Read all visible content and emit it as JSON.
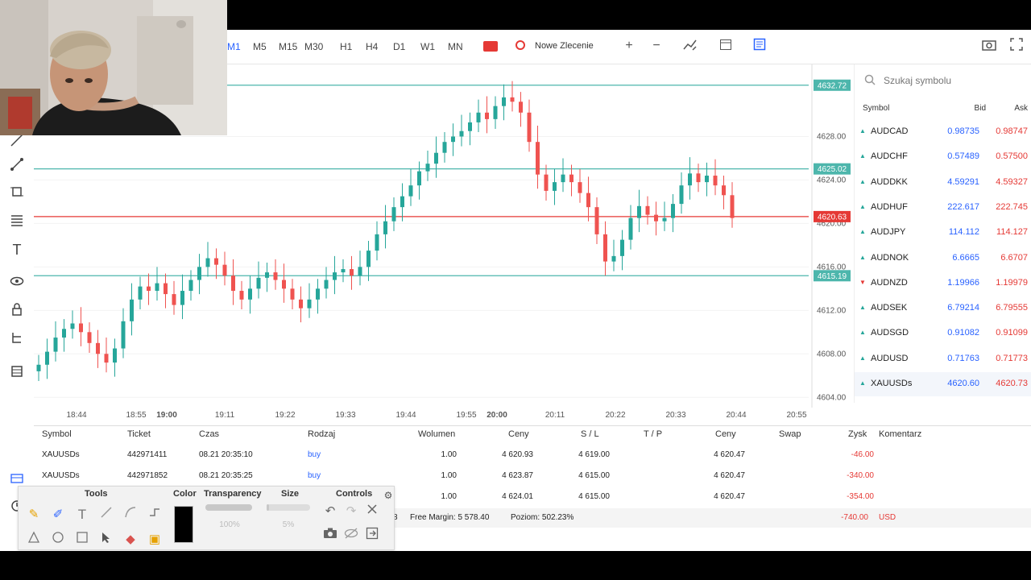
{
  "toolbar": {
    "timeframes": [
      "M1",
      "M5",
      "M15",
      "M30",
      "H1",
      "H4",
      "D1",
      "W1",
      "MN"
    ],
    "new_order_label": "Nowe Zlecenie",
    "icons": [
      "plus-icon",
      "minus-icon",
      "indicators-icon",
      "calendar-icon",
      "template-icon",
      "screenshot-icon",
      "fullscreen-icon"
    ]
  },
  "chart_data": {
    "type": "candlestick",
    "symbol": "XAUUSDs",
    "x_ticks": [
      "18:44",
      "18:55",
      "19:00",
      "19:11",
      "19:22",
      "19:33",
      "19:44",
      "19:55",
      "20:00",
      "20:11",
      "20:22",
      "20:33",
      "20:44",
      "20:55"
    ],
    "y_ticks": [
      "4628.00",
      "4624.00",
      "4620.00",
      "4616.00",
      "4612.00",
      "4608.00",
      "4604.00"
    ],
    "ylim": [
      4603.5,
      4633.0
    ],
    "horizontal_lines": [
      {
        "price": 4632.72,
        "label": "4632.72",
        "color": "#4db6ac"
      },
      {
        "price": 4625.02,
        "label": "4625.02",
        "color": "#4db6ac"
      },
      {
        "price": 4620.63,
        "label": "4620.63",
        "color": "#e53935"
      },
      {
        "price": 4615.19,
        "label": "4615.19",
        "color": "#4db6ac"
      }
    ],
    "up_color": "#26a69a",
    "down_color": "#ef5350",
    "closes": [
      4607.0,
      4608.2,
      4609.5,
      4610.3,
      4610.8,
      4610.0,
      4609.0,
      4608.0,
      4607.2,
      4608.5,
      4611.0,
      4613.0,
      4614.2,
      4613.8,
      4614.5,
      4613.5,
      4612.5,
      4613.8,
      4614.8,
      4616.0,
      4616.8,
      4616.2,
      4615.2,
      4613.8,
      4613.0,
      4614.0,
      4615.0,
      4615.5,
      4614.8,
      4614.0,
      4613.0,
      4612.2,
      4613.0,
      4614.0,
      4614.8,
      4615.5,
      4615.8,
      4615.2,
      4616.0,
      4617.5,
      4619.0,
      4620.2,
      4621.5,
      4622.5,
      4623.5,
      4624.8,
      4625.5,
      4626.5,
      4627.5,
      4628.0,
      4628.5,
      4629.3,
      4630.2,
      4629.6,
      4630.8,
      4631.6,
      4631.2,
      4630.2,
      4627.5,
      4624.5,
      4623.0,
      4623.8,
      4624.5,
      4623.8,
      4622.8,
      4621.5,
      4619.0,
      4616.5,
      4617.0,
      4618.5,
      4620.5,
      4621.6,
      4620.8,
      4620.2,
      4620.5,
      4621.8,
      4623.5,
      4624.6,
      4623.8,
      4624.4,
      4623.5,
      4622.6,
      4620.5
    ]
  },
  "watchlist": {
    "search_placeholder": "Szukaj symbolu",
    "headers": {
      "symbol": "Symbol",
      "bid": "Bid",
      "ask": "Ask"
    },
    "rows": [
      {
        "symbol": "AUDCAD",
        "bid": "0.98735",
        "ask": "0.98747",
        "dir": "up"
      },
      {
        "symbol": "AUDCHF",
        "bid": "0.57489",
        "ask": "0.57500",
        "dir": "up"
      },
      {
        "symbol": "AUDDKK",
        "bid": "4.59291",
        "ask": "4.59327",
        "dir": "up"
      },
      {
        "symbol": "AUDHUF",
        "bid": "222.617",
        "ask": "222.745",
        "dir": "up"
      },
      {
        "symbol": "AUDJPY",
        "bid": "114.112",
        "ask": "114.127",
        "dir": "up"
      },
      {
        "symbol": "AUDNOK",
        "bid": "6.6665",
        "ask": "6.6707",
        "dir": "up"
      },
      {
        "symbol": "AUDNZD",
        "bid": "1.19966",
        "ask": "1.19979",
        "dir": "down"
      },
      {
        "symbol": "AUDSEK",
        "bid": "6.79214",
        "ask": "6.79555",
        "dir": "up"
      },
      {
        "symbol": "AUDSGD",
        "bid": "0.91082",
        "ask": "0.91099",
        "dir": "up"
      },
      {
        "symbol": "AUDUSD",
        "bid": "0.71763",
        "ask": "0.71773",
        "dir": "up"
      },
      {
        "symbol": "XAUUSDs",
        "bid": "4620.60",
        "ask": "4620.73",
        "dir": "up"
      }
    ]
  },
  "positions": {
    "headers": [
      "Symbol",
      "Ticket",
      "Czas",
      "Rodzaj",
      "Wolumen",
      "Ceny",
      "S / L",
      "T / P",
      "Ceny",
      "Swap",
      "Zysk",
      "Komentarz"
    ],
    "rows": [
      {
        "symbol": "XAUUSDs",
        "ticket": "442971411",
        "time": "08.21 20:35:10",
        "type": "buy",
        "volume": "1.00",
        "open": "4 620.93",
        "sl": "4 619.00",
        "tp": "",
        "price": "4 620.47",
        "swap": "",
        "profit": "-46.00"
      },
      {
        "symbol": "XAUUSDs",
        "ticket": "442971852",
        "time": "08.21 20:35:25",
        "type": "buy",
        "volume": "1.00",
        "open": "4 623.87",
        "sl": "4 615.00",
        "tp": "",
        "price": "4 620.47",
        "swap": "",
        "profit": "-340.00"
      },
      {
        "symbol": "",
        "ticket": "",
        "time": "",
        "type": "",
        "volume": "1.00",
        "open": "4 624.01",
        "sl": "4 615.00",
        "tp": "",
        "price": "4 620.47",
        "swap": "",
        "profit": "-354.00"
      }
    ],
    "summary": {
      "prefix": "8",
      "free_margin": "Free Margin: 5 578.40",
      "level": "Poziom: 502.23%",
      "total": "-740.00",
      "currency": "USD"
    }
  },
  "annotation_panel": {
    "headers": {
      "tools": "Tools",
      "color": "Color",
      "transparency": "Transparency",
      "size": "Size",
      "controls": "Controls"
    },
    "transparency_value": "100%",
    "size_value": "5%",
    "selected_color": "#000000"
  }
}
